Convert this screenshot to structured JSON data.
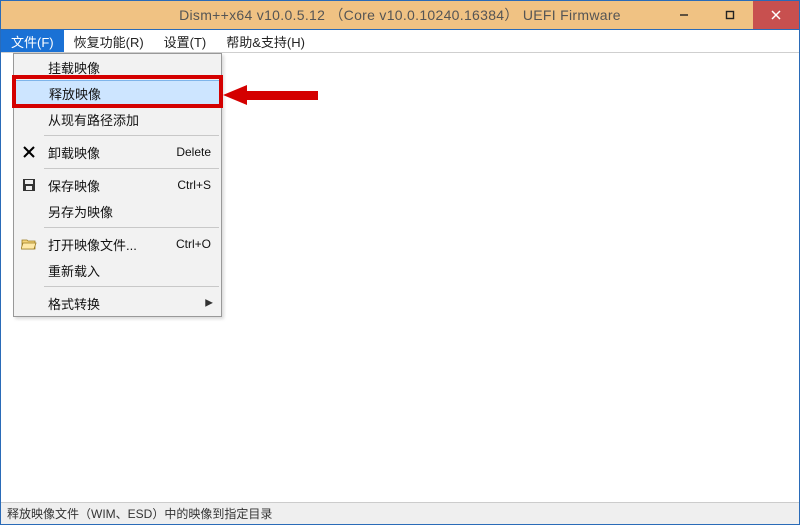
{
  "title": "Dism++x64 v10.0.5.12 （Core v10.0.10240.16384） UEFI Firmware",
  "menubar": {
    "file": "文件(F)",
    "recover": "恢复功能(R)",
    "settings": "设置(T)",
    "help": "帮助&支持(H)"
  },
  "dropdown": {
    "mount": "挂载映像",
    "release": "释放映像",
    "add_path": "从现有路径添加",
    "unmount": "卸载映像",
    "unmount_sc": "Delete",
    "save": "保存映像",
    "save_sc": "Ctrl+S",
    "save_as": "另存为映像",
    "open": "打开映像文件...",
    "open_sc": "Ctrl+O",
    "reload": "重新载入",
    "convert": "格式转换"
  },
  "status": "释放映像文件（WIM、ESD）中的映像到指定目录"
}
